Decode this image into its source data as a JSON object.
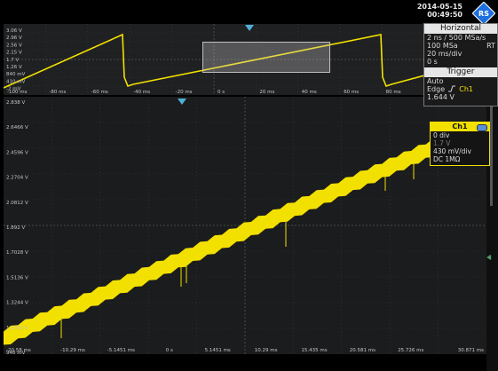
{
  "datetime": {
    "date": "2014-05-15",
    "time": "00:49:50"
  },
  "colors": {
    "trace": "#f2e000",
    "background": "#000000",
    "grid": "#3b3b3b",
    "axis_text": "#c6c6c6",
    "marker": "#4fb0d6"
  },
  "overview": {
    "y_labels": [
      "3.06 V",
      "2.96 V",
      "2.56 V",
      "2.15 V",
      "1.7 V",
      "1.26 V",
      "840 mV",
      "410 mV",
      "-2 mV"
    ],
    "x_labels": [
      "-100 ms",
      "-80 ms",
      "-60 ms",
      "-40 ms",
      "-20 ms",
      "0 s",
      "20 ms",
      "40 ms",
      "60 ms",
      "80 ms"
    ]
  },
  "main": {
    "y_labels": [
      "2.838 V",
      "2.6466 V",
      "2.4596 V",
      "2.2704 V",
      "2.0812 V",
      "1.892 V",
      "1.7028 V",
      "1.5136 V",
      "1.3244 V",
      "1.1352 V",
      "946 mV"
    ],
    "x_labels": [
      "-20.58 ms",
      "-10.29 ms",
      "-5.1451 ms",
      "0 s",
      "5.1451 ms",
      "10.29 ms",
      "15.435 ms",
      "20.581 ms",
      "25.726 ms",
      "30.871 ms"
    ],
    "x_labels_visible": [
      "-10.29 ms",
      "-5.1451 ms",
      "0 s",
      "5.1451 ms",
      "10.29 ms",
      "15.435 ms",
      "20.581 ms",
      "25.726 ms"
    ],
    "x_right_label": "30.871 ms",
    "x_left_label": "-20.58 ms"
  },
  "horizontal": {
    "title": "Horizontal",
    "rows": [
      "2 ns / 500 MSa/s",
      "100 MSa",
      "20 ms/div",
      "0 s"
    ],
    "mode": "RT"
  },
  "trigger": {
    "title": "Trigger",
    "mode": "Auto",
    "type": "Edge",
    "source": "Ch1",
    "level": "1.644 V"
  },
  "channel": {
    "title": "Ch1",
    "rows": [
      "0 div",
      "1.7 V",
      "430 mV/div",
      "DC 1MΩ"
    ]
  },
  "right_marker_label": "8"
}
